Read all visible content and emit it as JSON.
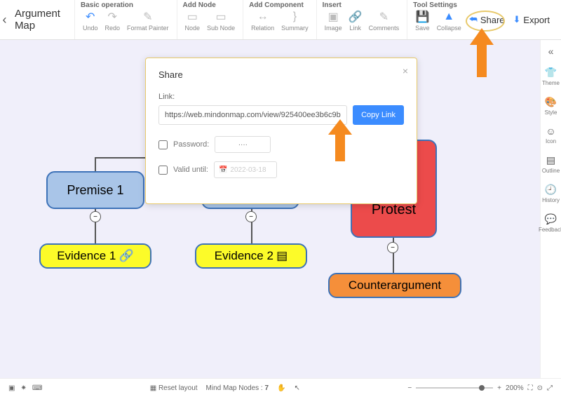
{
  "header": {
    "title": "Argument Map",
    "groups": [
      {
        "label": "Basic operation",
        "items": [
          {
            "name": "undo",
            "label": "Undo",
            "icon": "↶",
            "color": "#3b8cff"
          },
          {
            "name": "redo",
            "label": "Redo",
            "icon": "↷",
            "color": "#bbb"
          },
          {
            "name": "format-painter",
            "label": "Format Painter",
            "icon": "✎",
            "color": "#bbb"
          }
        ]
      },
      {
        "label": "Add Node",
        "items": [
          {
            "name": "node",
            "label": "Node",
            "icon": "▭",
            "color": "#bbb"
          },
          {
            "name": "sub-node",
            "label": "Sub Node",
            "icon": "▭",
            "color": "#bbb"
          }
        ]
      },
      {
        "label": "Add Component",
        "items": [
          {
            "name": "relation",
            "label": "Relation",
            "icon": "↔",
            "color": "#bbb"
          },
          {
            "name": "summary",
            "label": "Summary",
            "icon": "}",
            "color": "#bbb"
          }
        ]
      },
      {
        "label": "Insert",
        "items": [
          {
            "name": "image",
            "label": "Image",
            "icon": "▣",
            "color": "#bbb"
          },
          {
            "name": "link",
            "label": "Link",
            "icon": "🔗",
            "color": "#bbb"
          },
          {
            "name": "comments",
            "label": "Comments",
            "icon": "✎",
            "color": "#bbb"
          }
        ]
      },
      {
        "label": "Tool Settings",
        "items": [
          {
            "name": "save",
            "label": "Save",
            "icon": "💾",
            "color": "#bbb"
          },
          {
            "name": "collapse",
            "label": "Collapse",
            "icon": "▲",
            "color": "#3b8cff"
          }
        ]
      }
    ],
    "share_label": "Share",
    "export_label": "Export"
  },
  "sidebar": {
    "items": [
      {
        "name": "theme",
        "label": "Theme",
        "icon": "👕"
      },
      {
        "name": "style",
        "label": "Style",
        "icon": "🎨"
      },
      {
        "name": "icon",
        "label": "Icon",
        "icon": "☺"
      },
      {
        "name": "outline",
        "label": "Outline",
        "icon": "▤"
      },
      {
        "name": "history",
        "label": "History",
        "icon": "🕘"
      },
      {
        "name": "feedback",
        "label": "Feedback",
        "icon": "💬"
      }
    ]
  },
  "modal": {
    "title": "Share",
    "link_label": "Link:",
    "link_value": "https://web.mindonmap.com/view/925400ee3b6c9b",
    "copy_label": "Copy Link",
    "password_label": "Password:",
    "password_placeholder": "····",
    "valid_label": "Valid until:",
    "valid_placeholder": "2022-03-18"
  },
  "nodes": {
    "premise1": "Premise 1",
    "evidence1": "Evidence 1",
    "evidence2": "Evidence 2",
    "protest": "Protest",
    "counter": "Counterargument"
  },
  "footer": {
    "reset": "Reset layout",
    "nodes_label": "Mind Map Nodes :",
    "nodes_count": "7",
    "zoom": "200%"
  }
}
